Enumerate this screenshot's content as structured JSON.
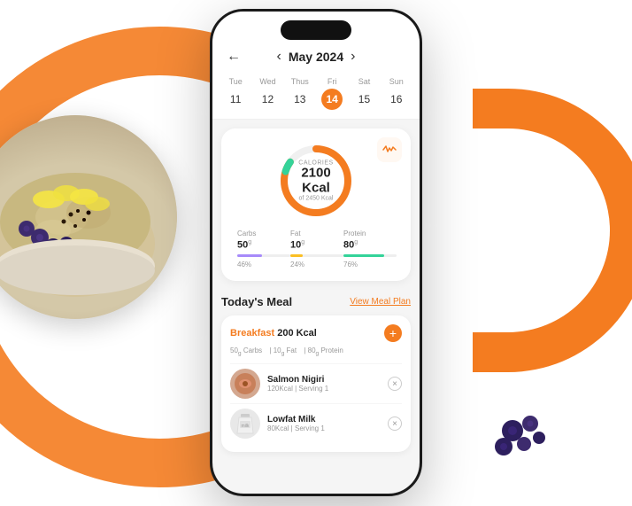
{
  "background": {
    "arc_color": "#f47c20"
  },
  "header": {
    "back_arrow": "←",
    "nav_left": "‹",
    "nav_right": "›",
    "month": "May 2024"
  },
  "calendar": {
    "days": [
      {
        "label": "Tue",
        "num": "11",
        "active": false
      },
      {
        "label": "Wed",
        "num": "12",
        "active": false
      },
      {
        "label": "Thus",
        "num": "13",
        "active": false
      },
      {
        "label": "Fri",
        "num": "14",
        "active": true
      },
      {
        "label": "Sat",
        "num": "15",
        "active": false
      },
      {
        "label": "Sun",
        "num": "16",
        "active": false
      }
    ]
  },
  "calories": {
    "label": "CALORIES",
    "value": "2100 Kcal",
    "sub": "of 2450 Kcal",
    "progress": 85,
    "activity_icon": "〰"
  },
  "macros": [
    {
      "title": "Carbs",
      "value": "50",
      "unit": "g",
      "pct": "46%",
      "color": "#a78bfa",
      "bar_pct": 46
    },
    {
      "title": "Fat",
      "value": "10",
      "unit": "g",
      "pct": "24%",
      "color": "#fbbf24",
      "bar_pct": 24
    },
    {
      "title": "Protein",
      "value": "80",
      "unit": "g",
      "pct": "76%",
      "color": "#34d399",
      "bar_pct": 76
    }
  ],
  "meal_section": {
    "title": "Today's Meal",
    "view_plan": "View Meal Plan"
  },
  "breakfast": {
    "type": "Breakfast",
    "kcal": "200 Kcal",
    "macros": "50g Carbs  |  10g Fat  |  80g Protein",
    "add_icon": "+",
    "items": [
      {
        "name": "Salmon Nigiri",
        "detail": "120Kcal | Serving 1",
        "icon": "🍣",
        "icon_bg": "#d4a890"
      },
      {
        "name": "Lowfat Milk",
        "detail": "80Kcal | Serving 1",
        "icon": "🥛",
        "icon_bg": "#f0f0f0"
      }
    ]
  }
}
